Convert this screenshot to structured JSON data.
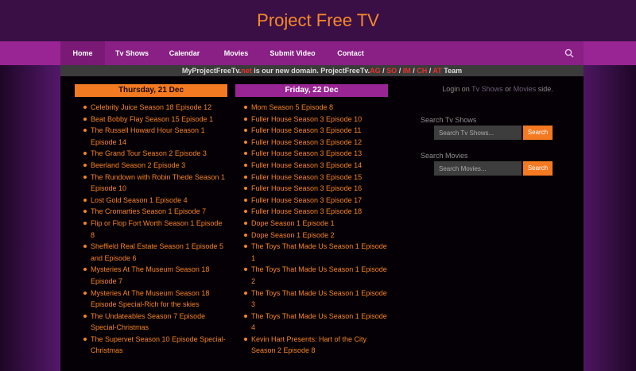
{
  "site": {
    "title": "Project Free TV"
  },
  "nav": {
    "items": [
      {
        "label": "Home",
        "active": true
      },
      {
        "label": "Tv Shows"
      },
      {
        "label": "Calendar"
      },
      {
        "label": "Movies"
      },
      {
        "label": "Submit Video"
      },
      {
        "label": "Contact"
      }
    ],
    "search_icon": "search-icon"
  },
  "notice": {
    "domain_prefix": "MyProjectFreeTv.",
    "tld_net": "net",
    "middle": " is our new domain. ProjectFreeTv.",
    "ag": "AG",
    "sep": " / ",
    "so": "SO",
    "im": "IM",
    "ch": "CH",
    "at": "AT",
    "suffix": " Team"
  },
  "columns": [
    {
      "header": "Thursday, 21 Dec",
      "episodes": [
        "Celebrity Juice Season 18 Episode 12",
        "Beat Bobby Flay Season 15 Episode 1",
        "The Russell Howard Hour Season 1 Episode 14",
        "The Grand Tour Season 2 Episode 3",
        "Beerland Season 2 Episode 3",
        "The Rundown with Robin Thede Season 1 Episode 10",
        "Lost Gold Season 1 Episode 4",
        "The Cromarties Season 1 Episode 7",
        "Flip or Flop Fort Worth Season 1 Episode 8",
        "Sheffield Real Estate Season 1 Episode 5 and Episode 6",
        "Mysteries At The Museum Season 18 Episode 7",
        "Mysteries At The Museum Season 18 Episode Special-Rich for the skies",
        "The Undateables Season 7 Episode Special-Christmas",
        "The Supervet Season 10 Episode Special-Christmas"
      ]
    },
    {
      "header": "Friday, 22 Dec",
      "episodes": [
        "Mom Season 5 Episode 8",
        "Fuller House Season 3 Episode 10",
        "Fuller House Season 3 Episode 11",
        "Fuller House Season 3 Episode 12",
        "Fuller House Season 3 Episode 13",
        "Fuller House Season 3 Episode 14",
        "Fuller House Season 3 Episode 15",
        "Fuller House Season 3 Episode 16",
        "Fuller House Season 3 Episode 17",
        "Fuller House Season 3 Episode 18",
        "Dope Season 1 Episode 1",
        "Dope Season 1 Episode 2",
        "The Toys That Made Us Season 1 Episode 1",
        "The Toys That Made Us Season 1 Episode 2",
        "The Toys That Made Us Season 1 Episode 3",
        "The Toys That Made Us Season 1 Episode 4",
        "Kevin Hart Presents: Hart of the City Season 2 Episode 8"
      ]
    }
  ],
  "sidebar": {
    "login_prefix": "Login on ",
    "login_tv": "Tv Shows",
    "login_or": " or ",
    "login_movies": "Movies",
    "login_suffix": " side.",
    "tv_label": "Search Tv Shows",
    "tv_placeholder": "Search Tv Shows...",
    "movies_label": "Search Movies",
    "movies_placeholder": "Search Movies...",
    "search_button": "Search"
  },
  "colors": {
    "accent_orange": "#f47a22",
    "nav_purple": "#992594",
    "background": "#2a0b33"
  }
}
